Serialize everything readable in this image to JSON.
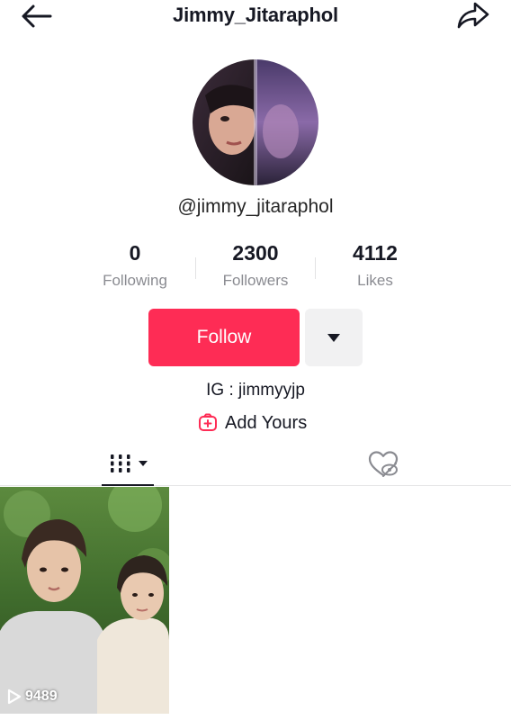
{
  "header": {
    "title": "Jimmy_Jitaraphol",
    "back_icon": "arrow-left-icon",
    "share_icon": "share-icon"
  },
  "profile": {
    "username": "@jimmy_jitaraphol",
    "bio": "IG : jimmyyjp",
    "add_yours": "Add Yours"
  },
  "stats": [
    {
      "value": "0",
      "label": "Following"
    },
    {
      "value": "2300",
      "label": "Followers"
    },
    {
      "value": "4112",
      "label": "Likes"
    }
  ],
  "actions": {
    "follow_label": "Follow",
    "more_icon": "triangle-down-icon"
  },
  "tabs": {
    "videos_icon": "grid-icon",
    "liked_icon": "heart-hidden-icon"
  },
  "videos": [
    {
      "views": "9489"
    }
  ],
  "colors": {
    "accent": "#fe2c55",
    "text": "#161823",
    "secondary": "#8a8b91"
  }
}
